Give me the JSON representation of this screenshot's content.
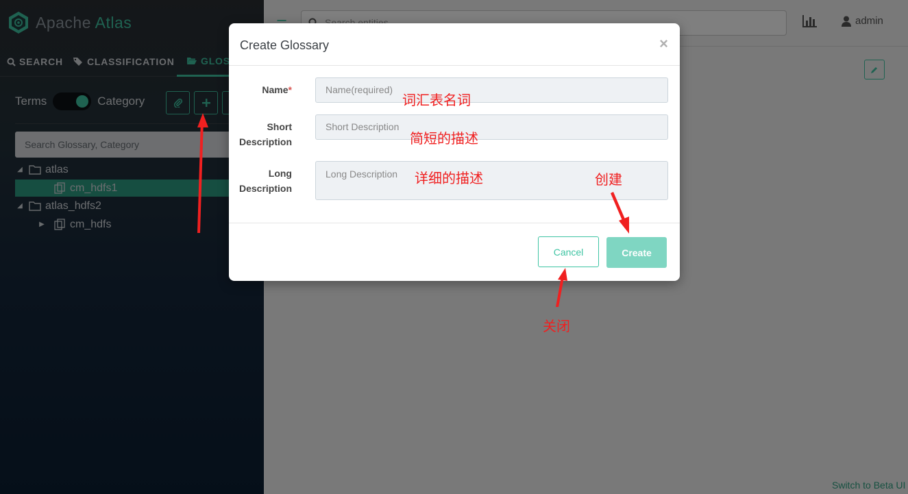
{
  "app": {
    "logo_part1": "Apache",
    "logo_part2": "Atlas"
  },
  "sidebar": {
    "tabs": [
      {
        "label": "SEARCH",
        "icon": "search-icon"
      },
      {
        "label": "CLASSIFICATION",
        "icon": "tag-icon"
      },
      {
        "label": "GLOS",
        "icon": "folder-open-icon"
      }
    ],
    "toggle": {
      "left_label": "Terms",
      "right_label": "Category"
    },
    "action_buttons": [
      {
        "icon": "paperclip-icon"
      },
      {
        "icon": "plus-icon"
      }
    ],
    "search_placeholder": "Search Glossary, Category",
    "tree": [
      {
        "label": "atlas",
        "icon": "folder-icon",
        "expanded": true
      },
      {
        "label": "cm_hdfs1",
        "icon": "copy-icon",
        "selected": true
      },
      {
        "label": "atlas_hdfs2",
        "icon": "folder-icon",
        "expanded": true
      },
      {
        "label": "cm_hdfs",
        "icon": "copy-icon",
        "expanded": false
      }
    ]
  },
  "header": {
    "search_placeholder": "Search entities",
    "user": "admin"
  },
  "footer": {
    "beta_link": "Switch to Beta UI"
  },
  "modal": {
    "title": "Create Glossary",
    "close": "×",
    "fields": {
      "name": {
        "label": "Name",
        "required_mark": "*",
        "placeholder": "Name(required)"
      },
      "short": {
        "label_line1": "Short",
        "label_line2": "Description",
        "placeholder": "Short Description"
      },
      "long": {
        "label_line1": "Long",
        "label_line2": "Description",
        "placeholder": "Long Description"
      }
    },
    "cancel_label": "Cancel",
    "create_label": "Create"
  },
  "annotations": {
    "name_note": "词汇表名词",
    "short_note": "简短的描述",
    "long_note": "详细的描述",
    "create_note": "创建",
    "close_note": "关闭"
  },
  "colors": {
    "accent": "#3ec4a3",
    "annotation": "#f02020",
    "create_button": "#7fd6c2"
  }
}
